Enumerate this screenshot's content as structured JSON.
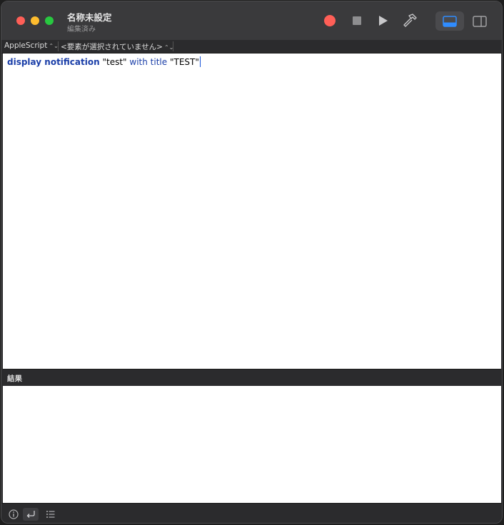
{
  "window": {
    "title": "名称未設定",
    "subtitle": "編集済み"
  },
  "toolbar": {
    "record": "record-icon",
    "stop": "stop-icon",
    "run": "play-icon",
    "compile": "hammer-icon",
    "view_bottom": "bottom-panel-icon",
    "view_side": "side-panel-icon",
    "record_color": "#ff5f57"
  },
  "navbar": {
    "language": "AppleScript",
    "element": "<要素が選択されていません>",
    "arrows": "⌃⌄"
  },
  "editor": {
    "code": {
      "kw1": "display notification",
      "str1": "\"test\"",
      "kw2": "with title",
      "str2": "\"TEST\""
    }
  },
  "result": {
    "label": "結果"
  },
  "bottombar": {
    "info": "info-icon",
    "return": "return-icon",
    "list": "list-icon"
  }
}
